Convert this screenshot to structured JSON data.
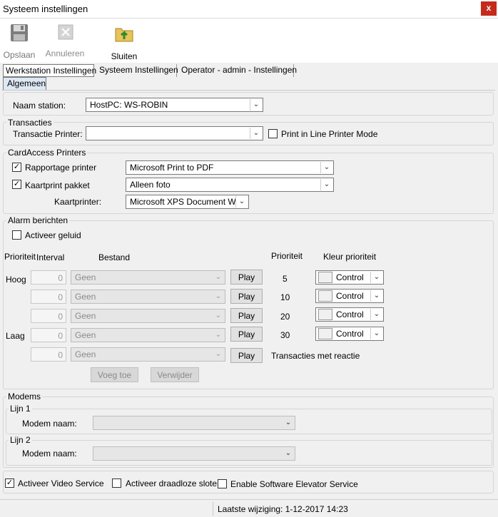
{
  "window": {
    "title": "Systeem instellingen",
    "close_glyph": "x"
  },
  "toolbar": {
    "save_label": "Opslaan",
    "cancel_label": "Annuleren",
    "close_label": "Sluiten",
    "save_icon": "floppy-disk-icon",
    "cancel_icon": "cancel-x-icon",
    "close_icon": "folder-exit-icon"
  },
  "tabs": [
    {
      "label": "Werkstation Instellingen",
      "active": true
    },
    {
      "label": "Systeem Instellingen",
      "active": false
    },
    {
      "label": "Operator - admin - Instellingen",
      "active": false
    }
  ],
  "subtab": {
    "label": "Algemeen"
  },
  "station": {
    "label": "Naam station:",
    "value": "HostPC: WS-ROBIN"
  },
  "transacties": {
    "group_label": "Transacties",
    "printer_label": "Transactie Printer:",
    "printer_value": "",
    "line_mode_label": "Print in Line Printer Mode",
    "line_mode_checked": false
  },
  "cardaccess": {
    "group_label": "CardAccess Printers",
    "rapport_label": "Rapportage printer",
    "rapport_checked": true,
    "rapport_value": "Microsoft Print to PDF",
    "kaartprint_label": "Kaartprint pakket",
    "kaartprint_checked": true,
    "kaartprint_value": "Alleen foto",
    "kaartprinter_label": "Kaartprinter:",
    "kaartprinter_value": "Microsoft XPS Document Wri"
  },
  "alarm": {
    "group_label": "Alarm berichten",
    "sound_label": "Activeer geluid",
    "sound_checked": false,
    "col_prioriteit": "Prioriteit",
    "col_interval": "Interval",
    "col_bestand": "Bestand",
    "col_prioriteit2": "Prioriteit",
    "col_kleur": "Kleur prioriteit",
    "play_label": "Play",
    "rows": [
      {
        "side": "Hoog",
        "interval": "0",
        "file": "Geen",
        "priority": "5",
        "color": "Control"
      },
      {
        "side": "",
        "interval": "0",
        "file": "Geen",
        "priority": "10",
        "color": "Control"
      },
      {
        "side": "",
        "interval": "0",
        "file": "Geen",
        "priority": "20",
        "color": "Control"
      },
      {
        "side": "Laag",
        "interval": "0",
        "file": "Geen",
        "priority": "30",
        "color": "Control"
      },
      {
        "side": "",
        "interval": "0",
        "file": "Geen",
        "priority": "Transacties met reactie",
        "color": ""
      }
    ],
    "add_label": "Voeg toe",
    "remove_label": "Verwijder"
  },
  "modems": {
    "group_label": "Modems",
    "line1_label": "Lijn 1",
    "line2_label": "Lijn 2",
    "modem_name_label": "Modem naam:",
    "line1_value": "",
    "line2_value": ""
  },
  "services": {
    "video_label": "Activeer Video Service",
    "video_checked": true,
    "wireless_label": "Activeer draadloze sloten",
    "wireless_checked": false,
    "elevator_label": "Enable Software Elevator Service",
    "elevator_checked": false
  },
  "status": {
    "last_change": "Laatste wijziging: 1-12-2017 14:23"
  }
}
